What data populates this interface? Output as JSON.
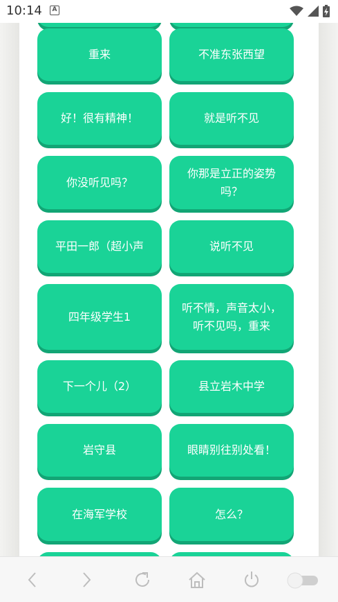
{
  "status": {
    "time": "10:14",
    "a_icon_label": "A"
  },
  "buttons": [
    {
      "label": "重来"
    },
    {
      "label": "不准东张西望"
    },
    {
      "label": "好！很有精神！"
    },
    {
      "label": "就是听不见"
    },
    {
      "label": "你没听见吗？"
    },
    {
      "label": "你那是立正的姿势吗？"
    },
    {
      "label": "平田一郎（超小声"
    },
    {
      "label": "说听不见"
    },
    {
      "label": "四年级学生1"
    },
    {
      "label": "听不情，声音太小，听不见吗，重来"
    },
    {
      "label": "下一个儿（2）"
    },
    {
      "label": "县立岩木中学"
    },
    {
      "label": "岩守县"
    },
    {
      "label": "眼睛别往别处看！"
    },
    {
      "label": "在海军学校"
    },
    {
      "label": "怎么？"
    }
  ],
  "nav": {
    "icons": [
      "back-icon",
      "forward-icon",
      "refresh-icon",
      "home-icon",
      "power-icon",
      "toggle-switch"
    ],
    "accent_color": "#1ad397",
    "shadow_color": "#12a575"
  }
}
